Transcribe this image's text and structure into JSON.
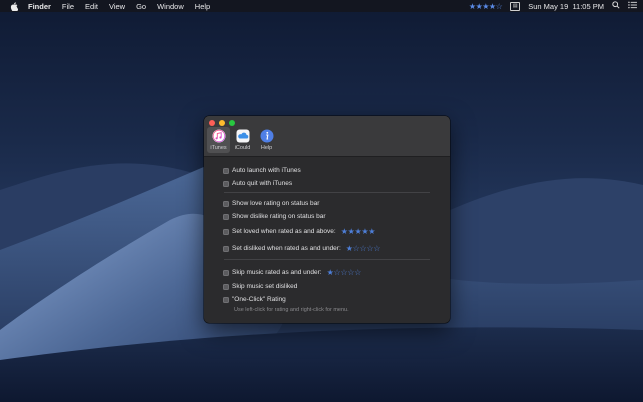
{
  "menubar": {
    "apple_icon": "apple-icon",
    "app_name": "Finder",
    "menus": [
      "File",
      "Edit",
      "View",
      "Go",
      "Window",
      "Help"
    ],
    "status_rating": "★★★★☆",
    "datetime": "Sun May 19  11:05 PM",
    "icons": [
      "rating-stars-icon",
      "menu-extra-box-icon",
      "spotlight-search-icon",
      "notification-center-icon"
    ]
  },
  "window": {
    "tabs": [
      {
        "label": "iTunes",
        "icon": "itunes-music-note-icon",
        "active": true
      },
      {
        "label": "iCould",
        "icon": "icloud-icon",
        "active": false
      },
      {
        "label": "Help",
        "icon": "info-icon",
        "active": false
      }
    ],
    "options": {
      "auto_launch": "Auto launch with iTunes",
      "auto_quit": "Auto quit with iTunes",
      "show_love": "Show love rating on status bar",
      "show_dislike": "Show dislike rating on status bar",
      "set_loved": "Set loved when rated as and above:",
      "set_loved_rating": "★★★★★",
      "set_disliked": "Set disliked when rated as and under:",
      "set_disliked_rating": "★☆☆☆☆",
      "skip_rated": "Skip music rated as and under:",
      "skip_rated_rating": "★☆☆☆☆",
      "skip_disliked": "Skip music set disliked",
      "one_click": "\"One-Click\" Rating",
      "one_click_hint": "Use left-click for rating and right-click for menu."
    }
  },
  "colors": {
    "accent_star": "#4e7fd9",
    "window_bg": "#2b2b2d"
  }
}
